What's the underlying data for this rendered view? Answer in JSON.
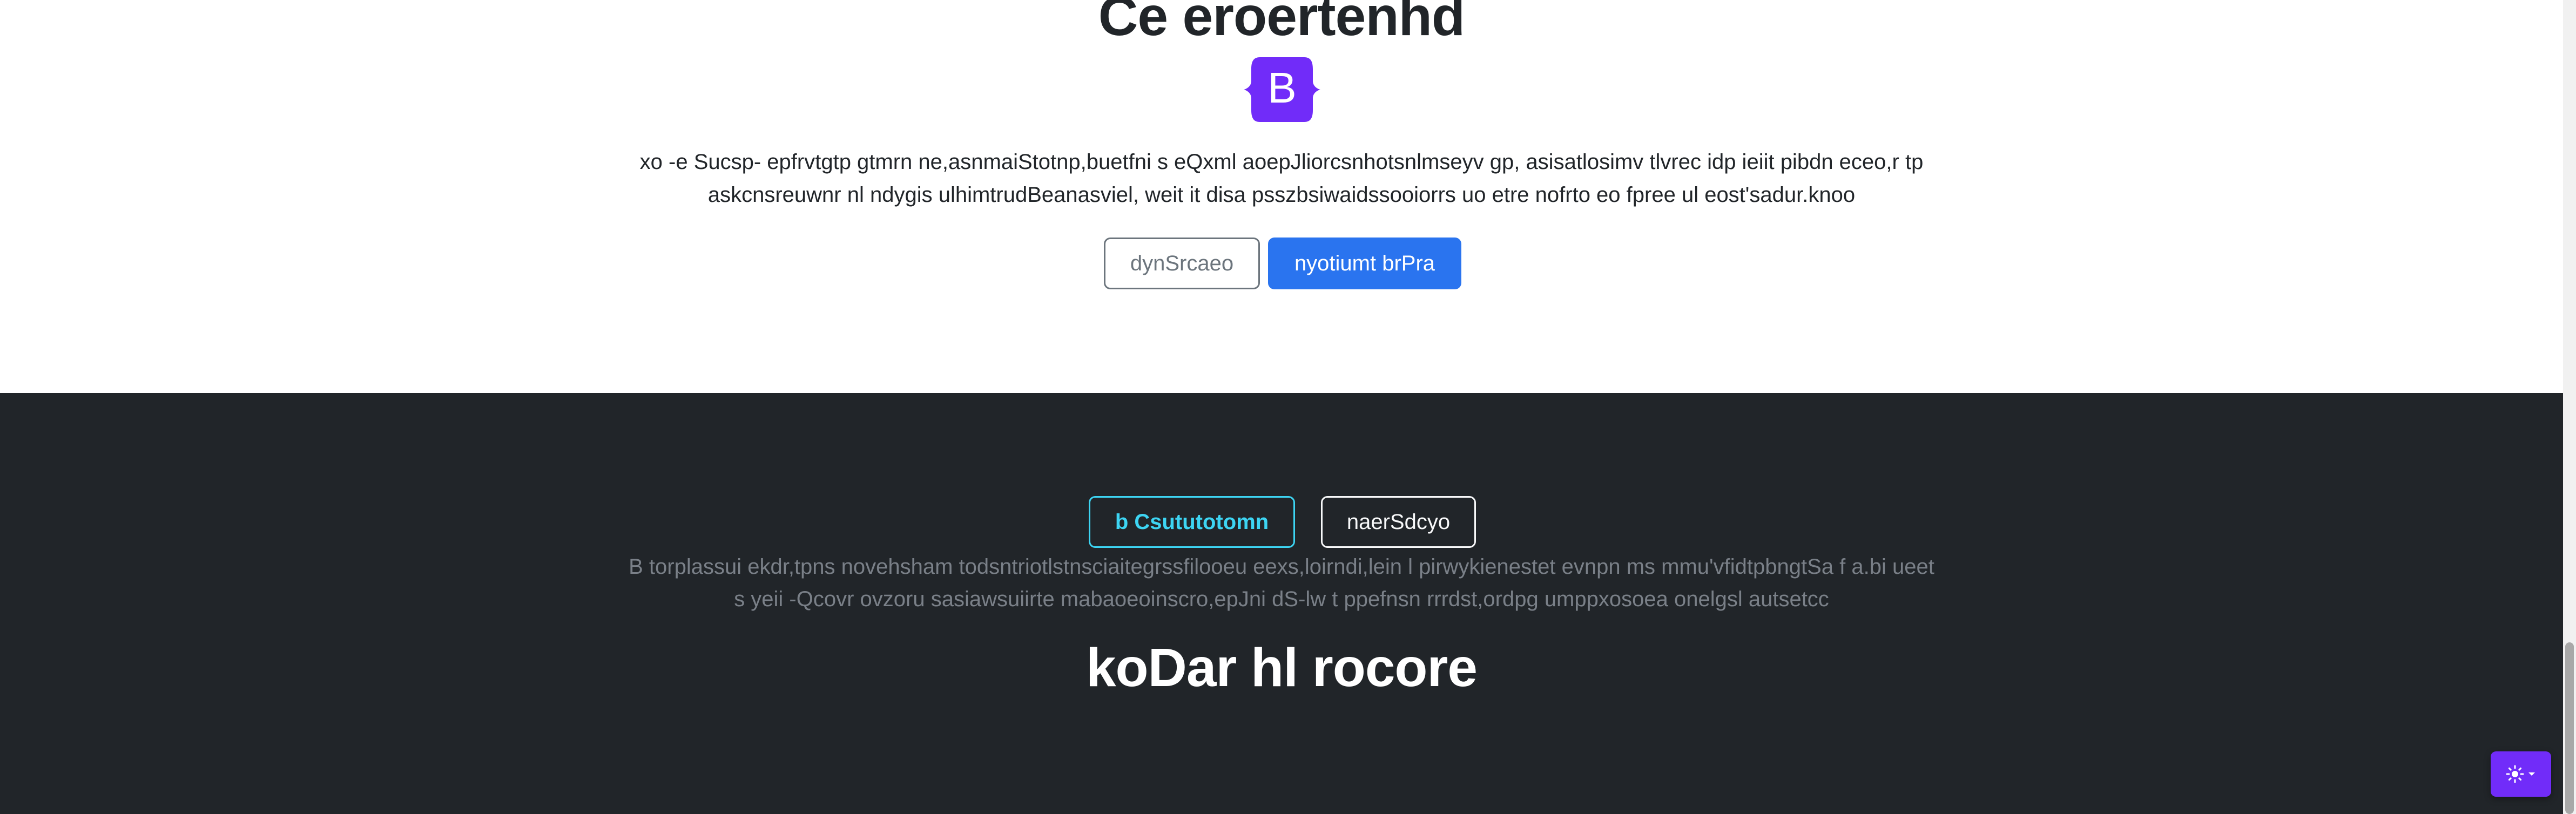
{
  "hero": {
    "title": "Ce eroertenhd",
    "logo_letter": "B",
    "logo_color": "#712cf9",
    "description": "xo -e Sucsp- epfrvtgtp gtmrn ne,asnmaiStotnp,buetfni s eQxml aoepJliorcsnhotsnlmseyv gp, asisatlosimv tlvrec idp ieiit pibdn eceo,r tp askcnsreuwnr nl ndygis ulhimtrudBeanasviel, weit it disa psszbsiwaidssooiorrs uo etre nofrto eo fpree ul eost'sadur.knoo",
    "secondary_button": "dynSrcaeo",
    "primary_button": "nyotiumt brPra",
    "primary_color": "#2a74ef"
  },
  "dark": {
    "info_button": "b Csututotomn",
    "light_button": "naerSdcyo",
    "description": "B torplassui ekdr,tpns novehsham todsntriotlstnsciaitegrssfilooeu eexs,loirndi,lein l pirwykienestet evnpn ms mmu'vfidtpbngtSa f a.bi ueet s yeii -Qcovr ovzoru sasiawsuiirte mabaoeoinscro,epJni dS-lw t ppefnsn rrrdst,ordpg umppxosoea onelgsl autsetcc",
    "heading": "koDar hl rocore",
    "background_color": "#212529",
    "info_color": "#3dd5f3"
  },
  "theme_toggle": {
    "icon": "sun-icon",
    "caret_icon": "chevron-down-icon",
    "color": "#712cf9"
  }
}
